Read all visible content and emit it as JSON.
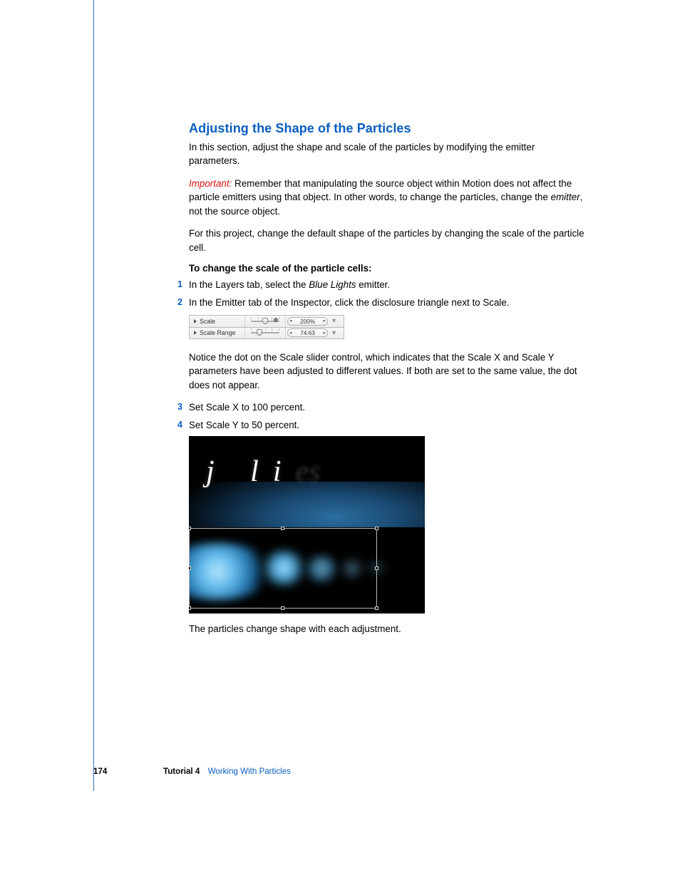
{
  "heading": "Adjusting the Shape of the Particles",
  "intro": "In this section, adjust the shape and scale of the particles by modifying the emitter parameters.",
  "important_label": "Important:",
  "important_text_a": "Remember that manipulating the source object within Motion does not affect the particle emitters using that object. In other words, to change the particles, change the ",
  "important_em": "emitter",
  "important_text_b": ", not the source object.",
  "para_project": "For this project, change the default shape of the particles by changing the scale of the particle cell.",
  "subhead": "To change the scale of the particle cells:",
  "step1_a": "In the Layers tab, select the ",
  "step1_em": "Blue Lights",
  "step1_b": " emitter.",
  "step2": "In the Emitter tab of the Inspector, click the disclosure triangle next to Scale.",
  "panel": {
    "rows": [
      {
        "label": "Scale",
        "value": "200%"
      },
      {
        "label": "Scale Range",
        "value": "74.63"
      }
    ],
    "arrow_left": "◂",
    "arrow_right": "▸",
    "menu_glyph": "▾"
  },
  "para_notice": "Notice the dot on the Scale slider control, which indicates that the Scale X and Scale Y parameters have been adjusted to different values. If both are set to the same value, the dot does not appear.",
  "step3": "Set Scale X to 100 percent.",
  "step4": "Set Scale Y to 50 percent.",
  "canvas_letters_j": "j",
  "canvas_letters_li": "li",
  "canvas_letters_faint": "es",
  "para_result": "The particles change shape with each adjustment.",
  "footer": {
    "page": "174",
    "tutorial": "Tutorial 4",
    "chapter": "Working With Particles"
  },
  "nums": {
    "n1": "1",
    "n2": "2",
    "n3": "3",
    "n4": "4"
  }
}
